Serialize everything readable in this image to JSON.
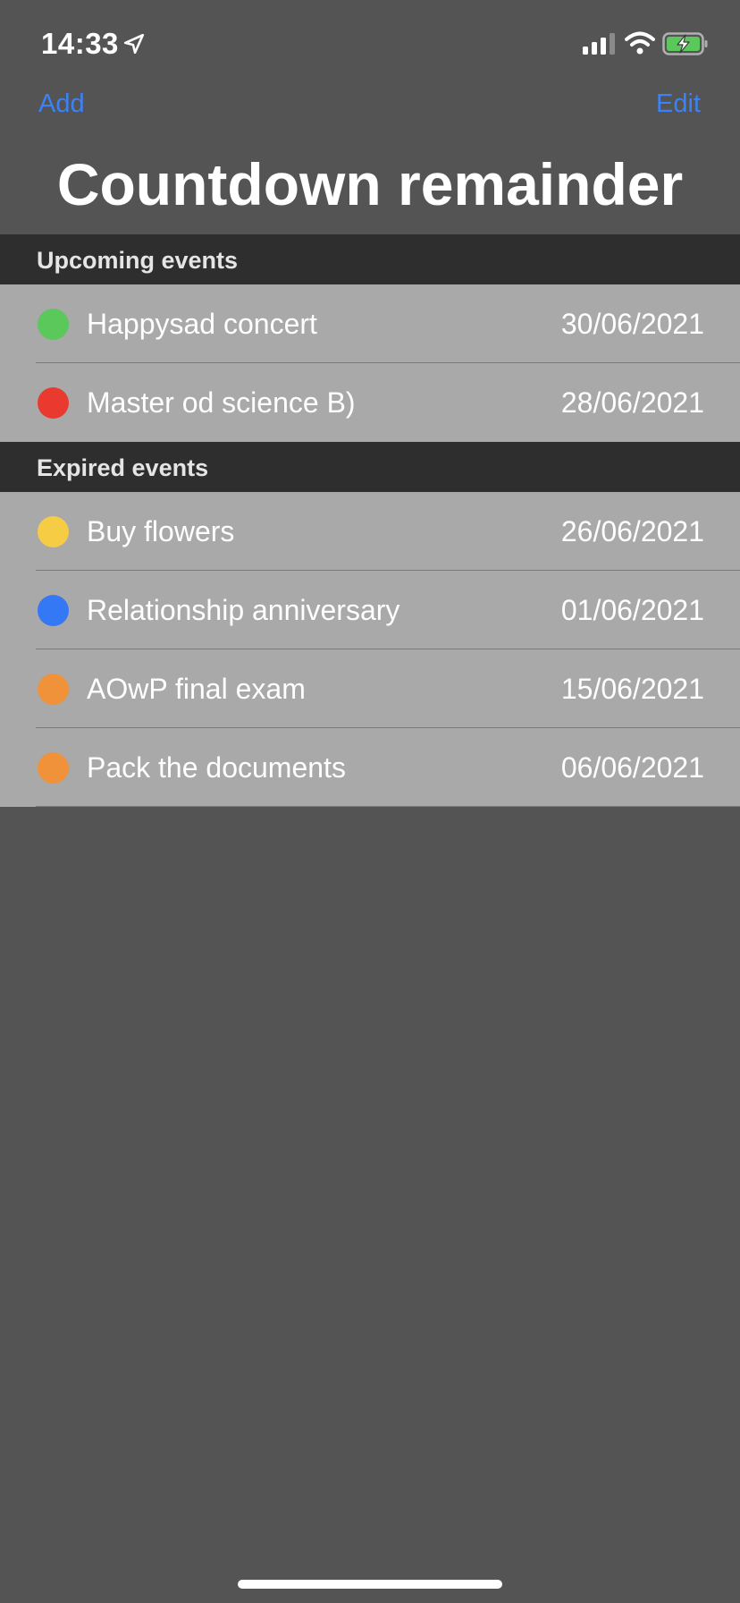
{
  "status": {
    "time": "14:33"
  },
  "nav": {
    "add_label": "Add",
    "edit_label": "Edit",
    "title": "Countdown remainder"
  },
  "sections": [
    {
      "header": "Upcoming events",
      "items": [
        {
          "title": "Happysad concert",
          "date": "30/06/2021",
          "color": "#5ac85a"
        },
        {
          "title": "Master od science B)",
          "date": "28/06/2021",
          "color": "#ea3a30"
        }
      ]
    },
    {
      "header": "Expired events",
      "items": [
        {
          "title": "Buy flowers",
          "date": "26/06/2021",
          "color": "#f6cc45"
        },
        {
          "title": "Relationship anniversary",
          "date": "01/06/2021",
          "color": "#3478f6"
        },
        {
          "title": "AOwP final exam",
          "date": "15/06/2021",
          "color": "#f0923a"
        },
        {
          "title": "Pack the documents",
          "date": "06/06/2021",
          "color": "#f0923a"
        }
      ]
    }
  ]
}
